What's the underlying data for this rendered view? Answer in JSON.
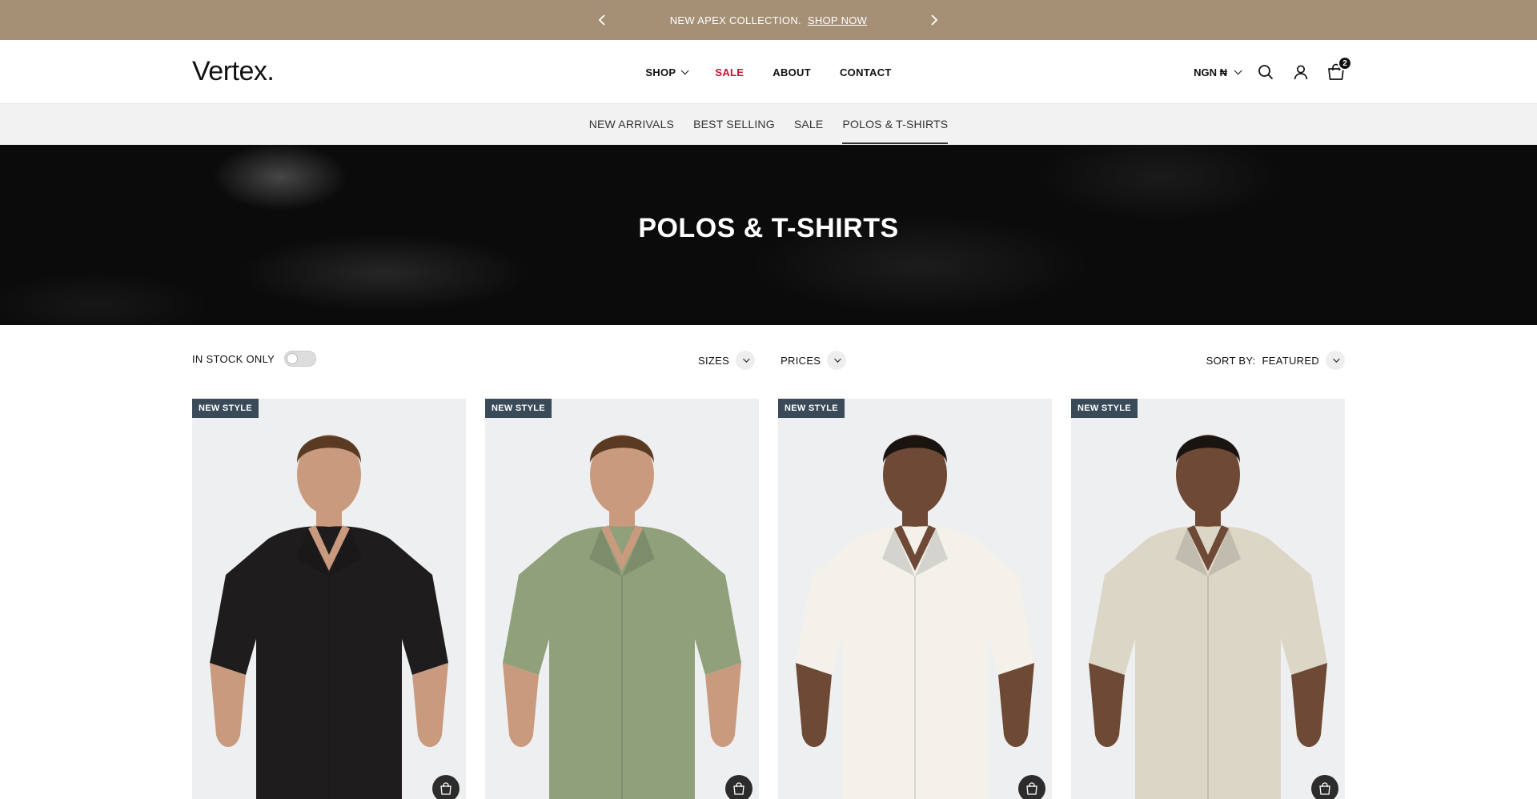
{
  "announcement": {
    "text": "NEW APEX COLLECTION.",
    "link": "SHOP NOW"
  },
  "header": {
    "logo": "Vertex.",
    "nav": [
      {
        "label": "SHOP",
        "has_dropdown": true
      },
      {
        "label": "SALE",
        "color": "#c8102e"
      },
      {
        "label": "ABOUT"
      },
      {
        "label": "CONTACT"
      }
    ],
    "currency": "NGN ₦",
    "cart_count": "2"
  },
  "subnav": {
    "items": [
      "NEW ARRIVALS",
      "BEST SELLING",
      "SALE",
      "POLOS & T-SHIRTS"
    ],
    "active": "POLOS & T-SHIRTS"
  },
  "hero": {
    "title": "POLOS & T-SHIRTS"
  },
  "filters": {
    "in_stock_label": "IN STOCK ONLY",
    "in_stock_enabled": false,
    "sizes_label": "SIZES",
    "prices_label": "PRICES",
    "sort_label": "SORT BY:",
    "sort_value": "FEATURED"
  },
  "products": [
    {
      "badge": "NEW STYLE",
      "shirt_color": "#1e1c1c",
      "skin": "#c99a7e",
      "hair": "#5a3a22"
    },
    {
      "badge": "NEW STYLE",
      "shirt_color": "#8fa07a",
      "skin": "#c99a7e",
      "hair": "#5a3a22"
    },
    {
      "badge": "NEW STYLE",
      "shirt_color": "#f3f1ea",
      "skin": "#6e4a36",
      "hair": "#1a1411"
    },
    {
      "badge": "NEW STYLE",
      "shirt_color": "#dcd6c6",
      "skin": "#6e4a36",
      "hair": "#1a1411"
    }
  ],
  "colors": {
    "announcement_bg": "#a58f75",
    "badge_bg": "#3a4a58",
    "sale_red": "#c8102e"
  }
}
